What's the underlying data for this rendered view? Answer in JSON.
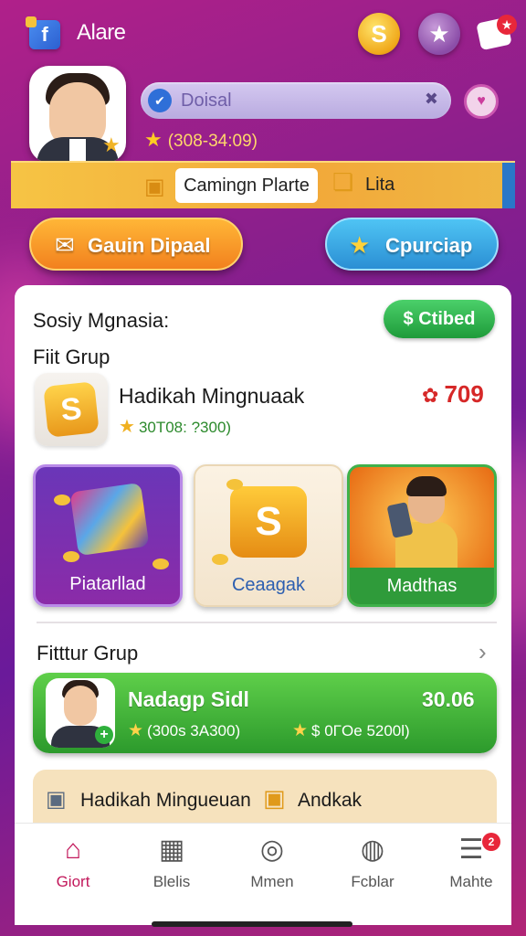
{
  "header": {
    "app_title": "Alare",
    "coin_symbol": "S",
    "star_symbol": "★",
    "notification_count": "★"
  },
  "profile": {
    "search_text": "Doisal",
    "score": "(308-34:09)"
  },
  "banner": {
    "chip_label": "Camingn Plarte",
    "tag_label": "Lita"
  },
  "actions": {
    "left_label": "Gauin Dipaal",
    "right_label": "Cpurciap"
  },
  "section1": {
    "title": "Sosiy Mgnasia:",
    "subscribed_label": "Ctibed",
    "subtitle": "Fiit Grup"
  },
  "featured": {
    "title": "Hadikah Mingnuaak",
    "subtitle": "30T08: ?300)",
    "badge_value": "709"
  },
  "cards": [
    {
      "label": "Piatarllad"
    },
    {
      "label": "Ceaagak"
    },
    {
      "label": "Madthas"
    }
  ],
  "section2": {
    "title": "Fitttur Grup"
  },
  "green_row": {
    "name": "Nadagp Sidl",
    "amount": "30.06",
    "sub1": "(300s 3A300)",
    "sub2": "$ 0ΓOe 5200l)"
  },
  "peach_row": {
    "label1": "Hadikah Mingueuan",
    "label2": "Andkak"
  },
  "nav": {
    "items": [
      {
        "label": "Giort",
        "icon": "home-icon"
      },
      {
        "label": "Blelis",
        "icon": "store-icon"
      },
      {
        "label": "Mmen",
        "icon": "target-icon"
      },
      {
        "label": "Fcblar",
        "icon": "lock-icon"
      },
      {
        "label": "Mahte",
        "icon": "menu-icon"
      }
    ],
    "badge_count": "2"
  },
  "colors": {
    "accent": "#c2185b",
    "green": "#2c9a2c",
    "orange": "#f2811e",
    "blue": "#2b8fd4"
  }
}
